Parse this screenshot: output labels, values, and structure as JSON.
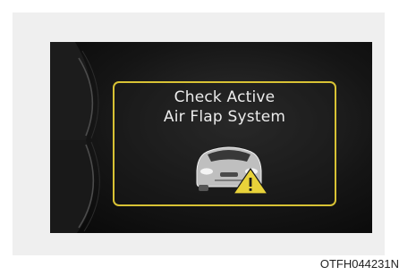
{
  "warning_message": {
    "line1": "Check Active",
    "line2": "Air Flap System"
  },
  "icons": {
    "car": "car-front-icon",
    "warning": "warning-triangle-icon"
  },
  "colors": {
    "background": "#ffffff",
    "frame": "#efefef",
    "display_bg": "#151515",
    "border_accent": "#d8c234",
    "text": "#ececec",
    "warning_triangle": "#e8d23a"
  },
  "image_code": "OTFH044231N"
}
